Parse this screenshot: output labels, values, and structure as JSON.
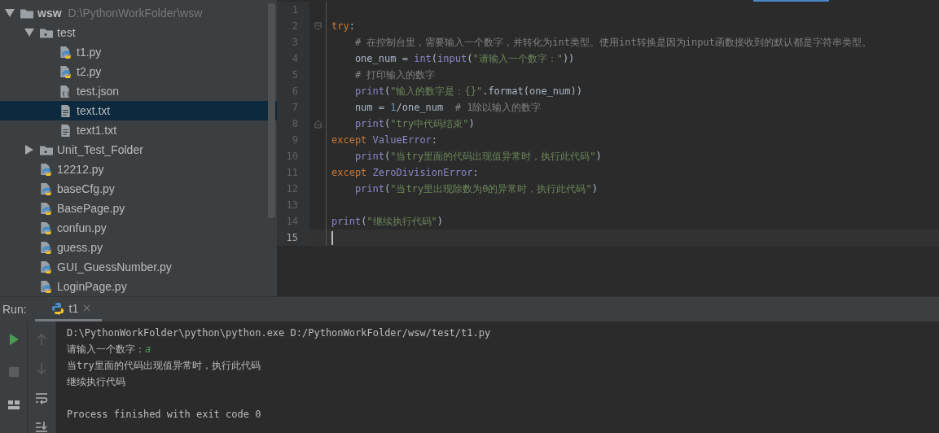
{
  "project_tree": [
    {
      "name": "wsw",
      "path": "D:\\PythonWorkFolder\\wsw",
      "kind": "folder",
      "expanded": true,
      "selected": false,
      "children": [
        {
          "name": "test",
          "kind": "package",
          "expanded": true,
          "selected": false,
          "children": [
            {
              "name": "t1.py",
              "kind": "python",
              "selected": false
            },
            {
              "name": "t2.py",
              "kind": "python",
              "selected": false
            },
            {
              "name": "test.json",
              "kind": "json",
              "selected": false
            },
            {
              "name": "text.txt",
              "kind": "text",
              "selected": true
            },
            {
              "name": "text1.txt",
              "kind": "text",
              "selected": false
            }
          ]
        },
        {
          "name": "Unit_Test_Folder",
          "kind": "package",
          "expanded": false,
          "selected": false
        },
        {
          "name": "12212.py",
          "kind": "python",
          "selected": false
        },
        {
          "name": "baseCfg.py",
          "kind": "python",
          "selected": false
        },
        {
          "name": "BasePage.py",
          "kind": "python",
          "selected": false
        },
        {
          "name": "confun.py",
          "kind": "python",
          "selected": false
        },
        {
          "name": "guess.py",
          "kind": "python",
          "selected": false
        },
        {
          "name": "GUI_GuessNumber.py",
          "kind": "python",
          "selected": false
        },
        {
          "name": "LoginPage.py",
          "kind": "python",
          "selected": false
        }
      ]
    }
  ],
  "editor": {
    "lines": [
      {
        "number": "1",
        "current": false
      },
      {
        "number": "2",
        "current": false,
        "fold_start": true,
        "tokens": [
          {
            "text": "try",
            "kind": "keyword"
          },
          {
            "text": ":",
            "kind": "plain"
          }
        ]
      },
      {
        "number": "3",
        "current": false,
        "tokens": [
          {
            "text": "    # 在控制台里，需要输入一个数字，并转化为int类型。使用int转换是因为input函数接收到的默认都是字符串类型。",
            "kind": "comment"
          }
        ]
      },
      {
        "number": "4",
        "current": false,
        "tokens": [
          {
            "text": "    one_num = ",
            "kind": "plain"
          },
          {
            "text": "int",
            "kind": "builtin"
          },
          {
            "text": "(",
            "kind": "plain"
          },
          {
            "text": "input",
            "kind": "builtin"
          },
          {
            "text": "(",
            "kind": "plain"
          },
          {
            "text": "\"请输入一个数字：\"",
            "kind": "string"
          },
          {
            "text": "))",
            "kind": "plain"
          }
        ]
      },
      {
        "number": "5",
        "current": false,
        "tokens": [
          {
            "text": "    # 打印输入的数字",
            "kind": "comment"
          }
        ]
      },
      {
        "number": "6",
        "current": false,
        "tokens": [
          {
            "text": "    print",
            "kind": "builtin"
          },
          {
            "text": "(",
            "kind": "plain"
          },
          {
            "text": "\"输入的数字是：{}\"",
            "kind": "string"
          },
          {
            "text": ".format(one_num))",
            "kind": "plain"
          }
        ]
      },
      {
        "number": "7",
        "current": false,
        "tokens": [
          {
            "text": "    num = ",
            "kind": "plain"
          },
          {
            "text": "1",
            "kind": "number"
          },
          {
            "text": "/one_num  ",
            "kind": "plain"
          },
          {
            "text": "# 1除以输入的数字",
            "kind": "comment"
          }
        ]
      },
      {
        "number": "8",
        "current": false,
        "fold_end": true,
        "tokens": [
          {
            "text": "    print",
            "kind": "builtin"
          },
          {
            "text": "(",
            "kind": "plain"
          },
          {
            "text": "\"try中代码结束\"",
            "kind": "string"
          },
          {
            "text": ")",
            "kind": "plain"
          }
        ]
      },
      {
        "number": "9",
        "current": false,
        "tokens": [
          {
            "text": "except ",
            "kind": "keyword"
          },
          {
            "text": "ValueError",
            "kind": "builtin"
          },
          {
            "text": ":",
            "kind": "plain"
          }
        ]
      },
      {
        "number": "10",
        "current": false,
        "tokens": [
          {
            "text": "    print",
            "kind": "builtin"
          },
          {
            "text": "(",
            "kind": "plain"
          },
          {
            "text": "\"当try里面的代码出现值异常时，执行此代码\"",
            "kind": "string"
          },
          {
            "text": ")",
            "kind": "plain"
          }
        ]
      },
      {
        "number": "11",
        "current": false,
        "tokens": [
          {
            "text": "except ",
            "kind": "keyword"
          },
          {
            "text": "ZeroDivisionError",
            "kind": "builtin"
          },
          {
            "text": ":",
            "kind": "plain"
          }
        ]
      },
      {
        "number": "12",
        "current": false,
        "tokens": [
          {
            "text": "    print",
            "kind": "builtin"
          },
          {
            "text": "(",
            "kind": "plain"
          },
          {
            "text": "\"当try里出现除数为0的异常时，执行此代码\"",
            "kind": "string"
          },
          {
            "text": ")",
            "kind": "plain"
          }
        ]
      },
      {
        "number": "13",
        "current": false
      },
      {
        "number": "14",
        "current": false,
        "tokens": [
          {
            "text": "print",
            "kind": "builtin"
          },
          {
            "text": "(",
            "kind": "plain"
          },
          {
            "text": "\"继续执行代码\"",
            "kind": "string"
          },
          {
            "text": ")",
            "kind": "plain"
          }
        ]
      },
      {
        "number": "15",
        "current": true
      }
    ]
  },
  "run_panel": {
    "label": "Run:",
    "tabs": [
      {
        "label": "t1",
        "selected": true
      }
    ],
    "console": [
      {
        "kind": "command",
        "text": "D:\\PythonWorkFolder\\python\\python.exe D:/PythonWorkFolder/wsw/test/t1.py"
      },
      {
        "kind": "prompt",
        "text": "请输入一个数字：",
        "input": "a"
      },
      {
        "kind": "output",
        "text": "当try里面的代码出现值异常时，执行此代码"
      },
      {
        "kind": "output",
        "text": "继续执行代码"
      },
      {
        "kind": "blank"
      },
      {
        "kind": "output",
        "text": "Process finished with exit code 0"
      }
    ]
  }
}
